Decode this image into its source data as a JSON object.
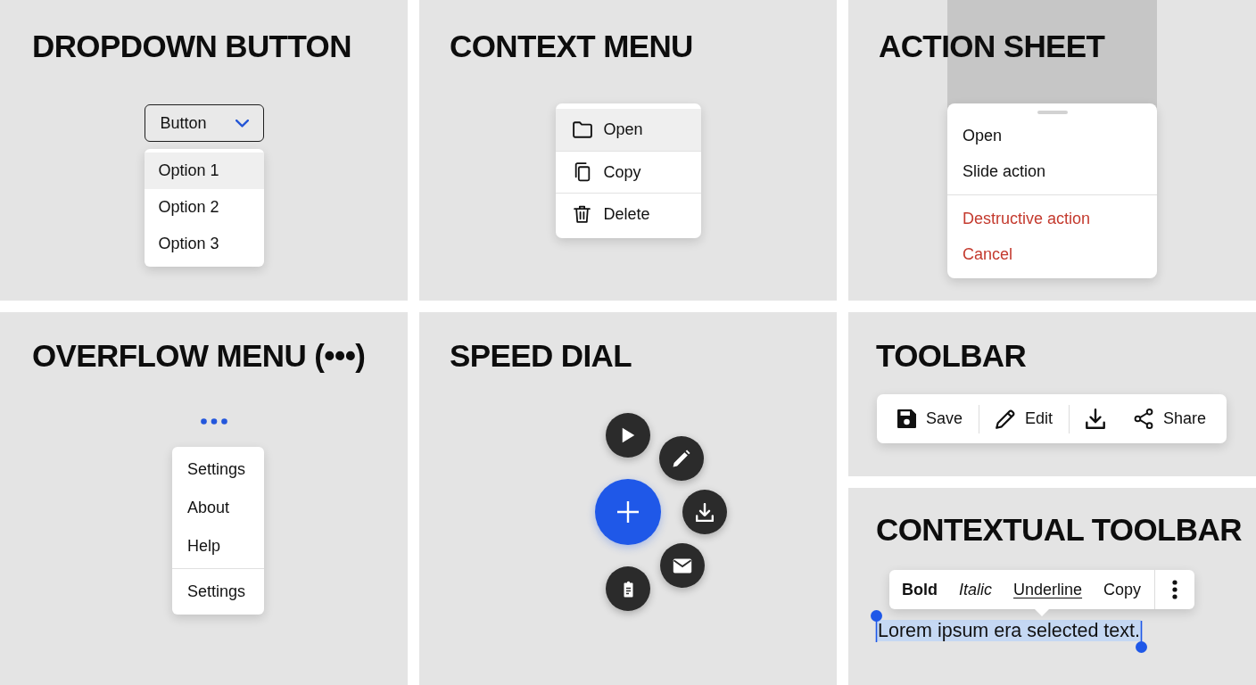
{
  "panels": [
    {
      "kind": "dropdown",
      "title": "DROPDOWN BUTTON",
      "button": {
        "label": "Button"
      },
      "options": [
        {
          "label": "Option 1",
          "selected": true
        },
        {
          "label": "Option 2",
          "selected": false
        },
        {
          "label": "Option 3",
          "selected": false
        }
      ]
    },
    {
      "kind": "context_menu",
      "title": "CONTEXT MENU",
      "items": [
        {
          "label": "Open",
          "selected": true
        },
        {
          "label": "Copy",
          "selected": false
        },
        {
          "label": "Delete",
          "selected": false
        }
      ]
    },
    {
      "kind": "action_sheet",
      "title": "ACTION SHEET",
      "groups": [
        {
          "items": [
            {
              "label": "Open",
              "destructive": false
            },
            {
              "label": "Slide action",
              "destructive": false
            }
          ]
        },
        {
          "items": [
            {
              "label": "Destructive action",
              "destructive": true
            },
            {
              "label": "Cancel",
              "destructive": true
            }
          ]
        }
      ]
    },
    {
      "kind": "overflow_menu",
      "title": "OVERFLOW MENU (•••)",
      "groups": [
        {
          "items": [
            {
              "label": "Settings"
            },
            {
              "label": "About"
            },
            {
              "label": "Help"
            }
          ]
        },
        {
          "items": [
            {
              "label": "Settings"
            }
          ]
        }
      ]
    },
    {
      "kind": "speed_dial",
      "title": "SPEED DIAL"
    },
    {
      "kind": "toolbar",
      "title": "TOOLBAR",
      "groups": [
        {
          "items": [
            {
              "kind": "labeled",
              "label": "Save"
            }
          ]
        },
        {
          "items": [
            {
              "kind": "labeled",
              "label": "Edit"
            }
          ]
        },
        {
          "items": [
            {
              "kind": "icon"
            },
            {
              "kind": "labeled",
              "label": "Share"
            }
          ]
        }
      ]
    },
    {
      "kind": "contextual_toolbar",
      "title": "CONTEXTUAL TOOLBAR",
      "items": [
        {
          "kind": "bold",
          "label": "Bold"
        },
        {
          "kind": "italic",
          "label": "Italic"
        },
        {
          "kind": "underline",
          "label": "Underline"
        },
        {
          "kind": "plain",
          "label": "Copy"
        }
      ],
      "selection": {
        "text": "Lorem ipsum era selected text."
      }
    }
  ]
}
